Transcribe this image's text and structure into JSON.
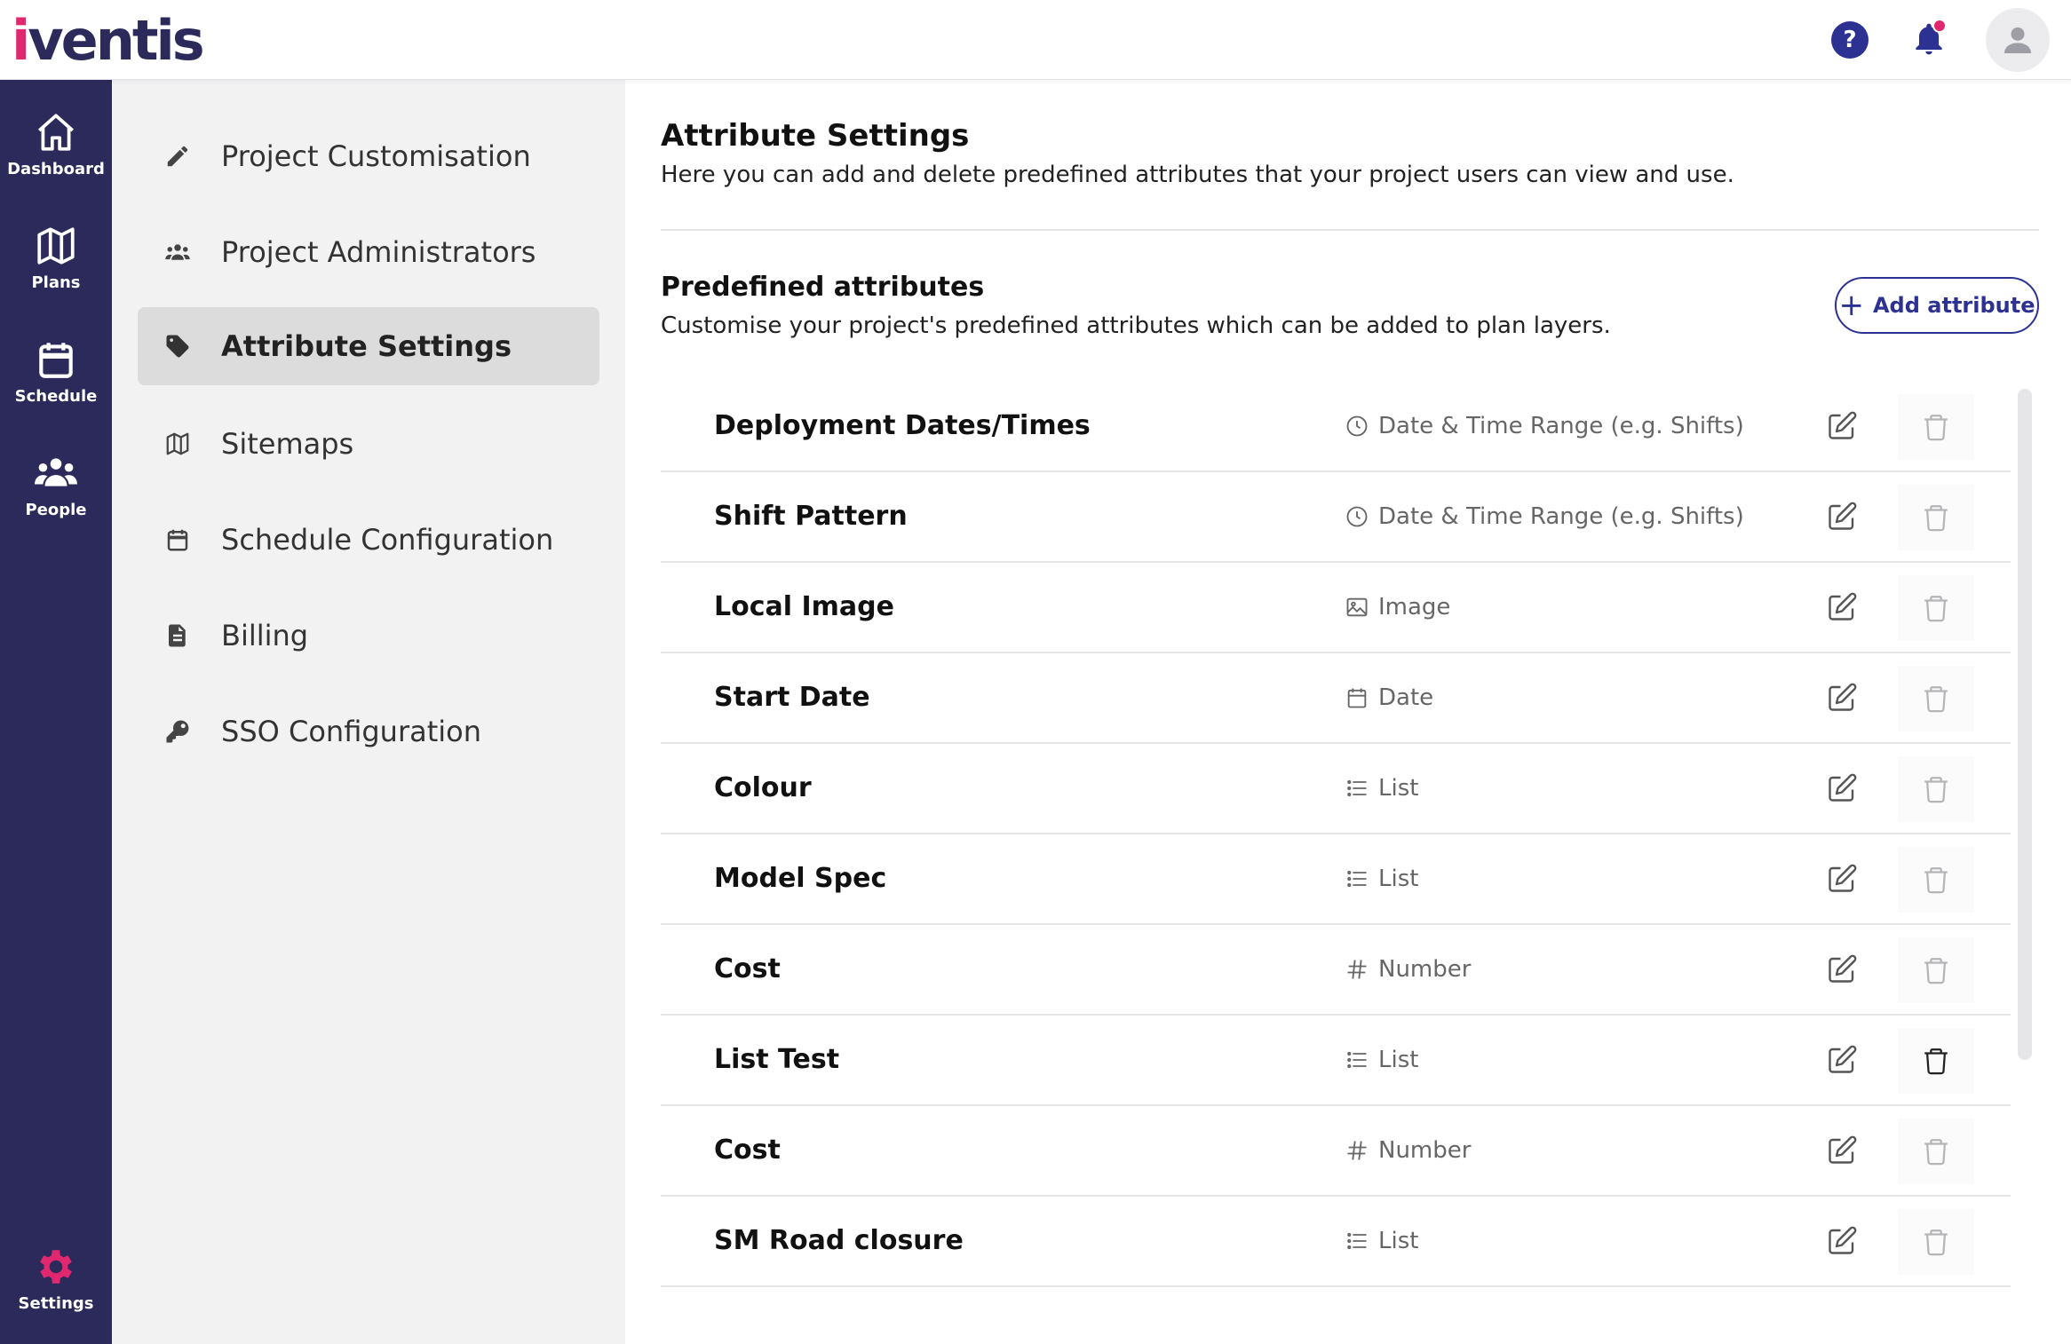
{
  "app": {
    "logo_text": "iventis",
    "brand_color": "#2b2a5a",
    "accent_color": "#e0286f",
    "primary_color": "#2c3192"
  },
  "topbar": {
    "help_label": "?",
    "help_icon": "question-circle-icon",
    "notification_icon": "bell-icon",
    "avatar_icon": "user-icon"
  },
  "rail": {
    "items": [
      {
        "label": "Dashboard",
        "icon": "home-icon"
      },
      {
        "label": "Plans",
        "icon": "map-icon"
      },
      {
        "label": "Schedule",
        "icon": "calendar-icon"
      },
      {
        "label": "People",
        "icon": "people-icon"
      }
    ],
    "settings": {
      "label": "Settings",
      "icon": "gear-icon",
      "color": "#e0286f"
    }
  },
  "subnav": {
    "items": [
      {
        "label": "Project Customisation",
        "icon": "pencil-icon"
      },
      {
        "label": "Project Administrators",
        "icon": "users-icon"
      },
      {
        "label": "Attribute Settings",
        "icon": "tag-icon",
        "active": true
      },
      {
        "label": "Sitemaps",
        "icon": "map-icon"
      },
      {
        "label": "Schedule Configuration",
        "icon": "calendar-icon"
      },
      {
        "label": "Billing",
        "icon": "document-icon"
      },
      {
        "label": "SSO Configuration",
        "icon": "key-icon"
      }
    ]
  },
  "main": {
    "title": "Attribute Settings",
    "description": "Here you can add and delete predefined attributes that your project users can view and use.",
    "section_title": "Predefined attributes",
    "section_description": "Customise your project's predefined attributes which can be added to plan layers.",
    "add_button_label": "Add attribute",
    "attributes": [
      {
        "name": "Deployment Dates/Times",
        "type": "Date & Time Range (e.g. Shifts)",
        "type_icon": "clock-icon",
        "delete_enabled": false
      },
      {
        "name": "Shift Pattern",
        "type": "Date & Time Range (e.g. Shifts)",
        "type_icon": "clock-icon",
        "delete_enabled": false
      },
      {
        "name": "Local Image",
        "type": "Image",
        "type_icon": "image-icon",
        "delete_enabled": false
      },
      {
        "name": "Start Date",
        "type": "Date",
        "type_icon": "calendar-icon",
        "delete_enabled": false
      },
      {
        "name": "Colour",
        "type": "List",
        "type_icon": "list-icon",
        "delete_enabled": false
      },
      {
        "name": "Model Spec",
        "type": "List",
        "type_icon": "list-icon",
        "delete_enabled": false
      },
      {
        "name": "Cost",
        "type": "Number",
        "type_icon": "hash-icon",
        "delete_enabled": false
      },
      {
        "name": "List Test",
        "type": "List",
        "type_icon": "list-icon",
        "delete_enabled": true
      },
      {
        "name": "Cost",
        "type": "Number",
        "type_icon": "hash-icon",
        "delete_enabled": false
      },
      {
        "name": "SM Road closure",
        "type": "List",
        "type_icon": "list-icon",
        "delete_enabled": false
      }
    ]
  }
}
